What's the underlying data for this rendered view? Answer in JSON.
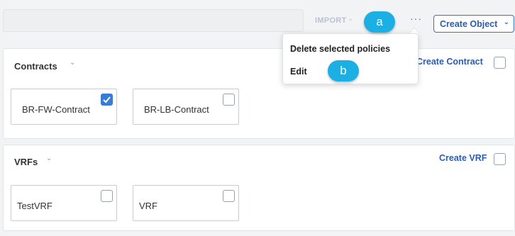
{
  "toolbar": {
    "import_label": "IMPORT",
    "more_label": "···",
    "create_object_label": "Create Object"
  },
  "popup_menu": {
    "items": [
      {
        "label": "Delete selected policies"
      },
      {
        "label": "Edit"
      }
    ]
  },
  "callouts": {
    "a": "a",
    "b": "b"
  },
  "contracts": {
    "title": "Contracts",
    "create_label": "Create Contract",
    "items": [
      {
        "label": "BR-FW-Contract",
        "checked": true
      },
      {
        "label": "BR-LB-Contract",
        "checked": false
      }
    ]
  },
  "vrfs": {
    "title": "VRFs",
    "create_label": "Create VRF",
    "items": [
      {
        "label": "TestVRF",
        "checked": false
      },
      {
        "label": "VRF",
        "checked": false
      }
    ]
  },
  "colors": {
    "accent": "#2a5db0",
    "callout": "#1bafe3",
    "checked": "#3a7bd5"
  }
}
